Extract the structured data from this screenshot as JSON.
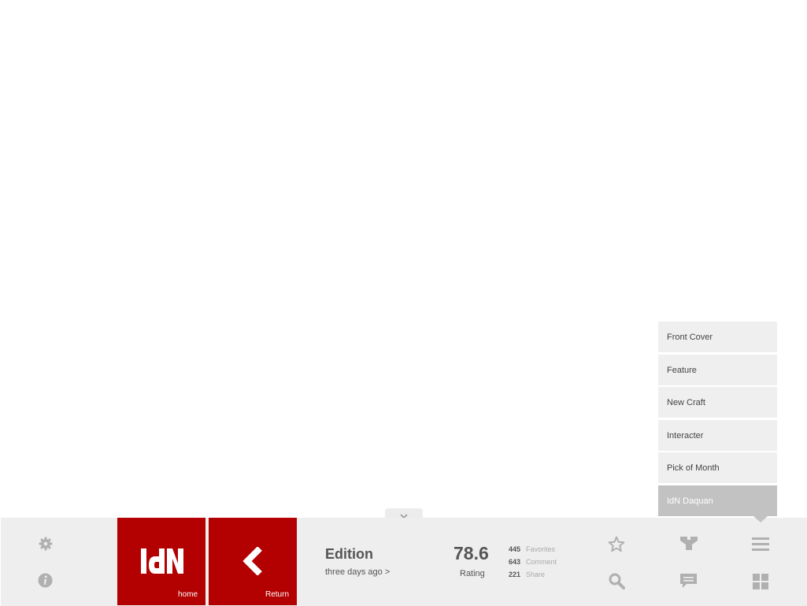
{
  "menu": {
    "items": [
      {
        "label": "Front Cover"
      },
      {
        "label": "Feature"
      },
      {
        "label": "New Craft"
      },
      {
        "label": "Interacter"
      },
      {
        "label": "Pick of Month"
      },
      {
        "label": "IdN Daquan"
      }
    ],
    "active_index": 5
  },
  "tiles": {
    "home": {
      "logo": "IdN",
      "label": "home"
    },
    "return": {
      "label": "Return"
    }
  },
  "edition": {
    "title": "Edition",
    "date": "three days ago >"
  },
  "rating": {
    "value": "78.6",
    "label": "Rating"
  },
  "stats": [
    {
      "count": "445",
      "label": "Favorites"
    },
    {
      "count": "643",
      "label": "Comment"
    },
    {
      "count": "221",
      "label": "Share"
    }
  ],
  "icons": {
    "settings": "gear-icon",
    "info": "info-icon",
    "favorite": "star-icon",
    "share": "share-icon",
    "menu": "menu-icon",
    "search": "search-icon",
    "comment": "comment-icon",
    "grid": "grid-icon"
  },
  "colors": {
    "brand": "#b30000",
    "bar_bg": "#eeeeee",
    "icon_gray": "#b0b0b0",
    "menu_active": "#c2c2c2"
  }
}
